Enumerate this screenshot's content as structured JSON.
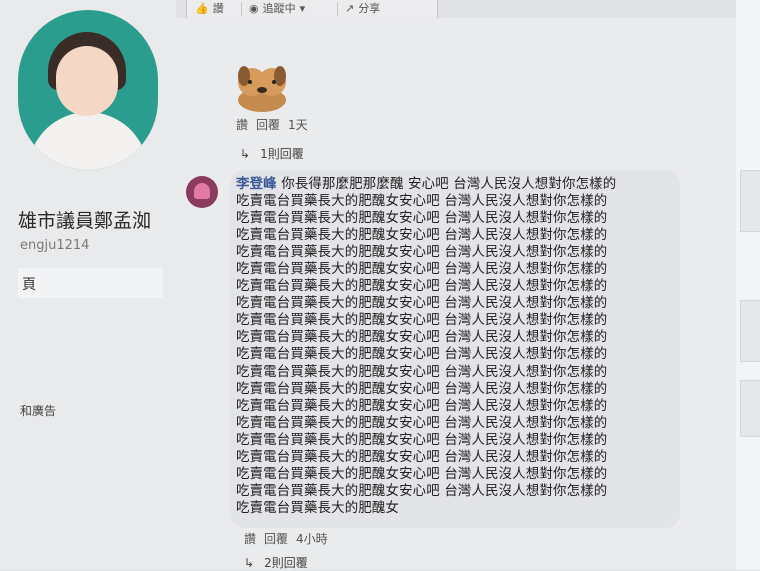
{
  "toolbar": {
    "like_label": "讚",
    "follow_label": "追蹤中",
    "share_label": "分享"
  },
  "profile": {
    "page_name": "雄市議員鄭孟洳",
    "username": "engju1214",
    "box_label": "頁",
    "footer_link": "和廣告"
  },
  "comment1": {
    "like": "讚",
    "reply": "回覆",
    "time": "1天",
    "replies_toggle": "1則回覆"
  },
  "comment2": {
    "author": "李登峰",
    "lines": [
      "你長得那麼肥那麼醜 安心吧 台灣人民沒人想對你怎樣的",
      "吃賣電台買藥長大的肥醜女安心吧 台灣人民沒人想對你怎樣的",
      "吃賣電台買藥長大的肥醜女安心吧 台灣人民沒人想對你怎樣的",
      "吃賣電台買藥長大的肥醜女安心吧 台灣人民沒人想對你怎樣的",
      "吃賣電台買藥長大的肥醜女安心吧 台灣人民沒人想對你怎樣的",
      "吃賣電台買藥長大的肥醜女安心吧 台灣人民沒人想對你怎樣的",
      "吃賣電台買藥長大的肥醜女安心吧 台灣人民沒人想對你怎樣的",
      "吃賣電台買藥長大的肥醜女安心吧 台灣人民沒人想對你怎樣的",
      "吃賣電台買藥長大的肥醜女安心吧 台灣人民沒人想對你怎樣的",
      "吃賣電台買藥長大的肥醜女安心吧 台灣人民沒人想對你怎樣的",
      "吃賣電台買藥長大的肥醜女安心吧 台灣人民沒人想對你怎樣的",
      "吃賣電台買藥長大的肥醜女安心吧 台灣人民沒人想對你怎樣的",
      "吃賣電台買藥長大的肥醜女安心吧 台灣人民沒人想對你怎樣的",
      "吃賣電台買藥長大的肥醜女安心吧 台灣人民沒人想對你怎樣的",
      "吃賣電台買藥長大的肥醜女安心吧 台灣人民沒人想對你怎樣的",
      "吃賣電台買藥長大的肥醜女安心吧 台灣人民沒人想對你怎樣的",
      "吃賣電台買藥長大的肥醜女安心吧 台灣人民沒人想對你怎樣的",
      "吃賣電台買藥長大的肥醜女安心吧 台灣人民沒人想對你怎樣的",
      "吃賣電台買藥長大的肥醜女安心吧 台灣人民沒人想對你怎樣的",
      "吃賣電台買藥長大的肥醜女"
    ],
    "like": "讚",
    "reply": "回覆",
    "time": "4小時",
    "replies_toggle": "2則回覆"
  },
  "icons": {
    "rss": "rss-icon",
    "share": "share-icon",
    "reply_arrow": "reply-arrow-icon"
  }
}
